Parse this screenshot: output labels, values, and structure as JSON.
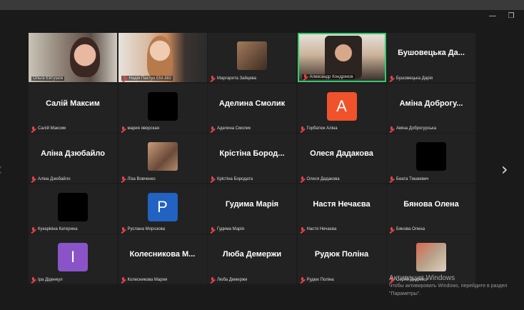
{
  "window": {
    "min_icon": "—",
    "max_icon": "❐"
  },
  "nav": {
    "left_icon": "‹",
    "right_icon": "›"
  },
  "tiles": [
    {
      "row": 0,
      "col": 0,
      "type": "video",
      "label": "Ольга Євтушок",
      "mic": false
    },
    {
      "row": 0,
      "col": 1,
      "type": "video",
      "label": "Надія Пастух ЕМ-382",
      "mic": true
    },
    {
      "row": 0,
      "col": 2,
      "type": "photo",
      "label": "Маргарита Зайцева",
      "mic": true
    },
    {
      "row": 0,
      "col": 3,
      "type": "video",
      "label": "Александр Кондряков",
      "mic": true,
      "active": true
    },
    {
      "row": 0,
      "col": 4,
      "type": "name",
      "name": "Бушовецька Да...",
      "label": "Бушовецька Дарія",
      "mic": true
    },
    {
      "row": 1,
      "col": 0,
      "type": "name",
      "name": "Салій Максим",
      "label": "Салій Максим",
      "mic": true
    },
    {
      "row": 1,
      "col": 1,
      "type": "avatar",
      "avatar": "",
      "avatar_color": "#000000",
      "label": "мария яворская",
      "mic": true
    },
    {
      "row": 1,
      "col": 2,
      "type": "name",
      "name": "Аделина Смолик",
      "label": "Аделина Смолик",
      "mic": true
    },
    {
      "row": 1,
      "col": 3,
      "type": "avatar",
      "avatar": "A",
      "avatar_color": "#f0522c",
      "label": "Горбатюк Аліна",
      "mic": true
    },
    {
      "row": 1,
      "col": 4,
      "type": "name",
      "name": "Аміна Доброгу...",
      "label": "Аміна Доброгурська",
      "mic": true
    },
    {
      "row": 2,
      "col": 0,
      "type": "name",
      "name": "Аліна Дзюбайло",
      "label": "Аліна Дзюбайло",
      "mic": true
    },
    {
      "row": 2,
      "col": 1,
      "type": "photo",
      "label": "Ліза Вовченко",
      "mic": true
    },
    {
      "row": 2,
      "col": 2,
      "type": "name",
      "name": "Крістіна Бород...",
      "label": "Крістіна Бородата",
      "mic": true
    },
    {
      "row": 2,
      "col": 3,
      "type": "name",
      "name": "Олеся Дадакова",
      "label": "Олеся Дадакова",
      "mic": true
    },
    {
      "row": 2,
      "col": 4,
      "type": "avatar",
      "avatar": "",
      "avatar_color": "#000000",
      "label": "Беата Тишкевич",
      "mic": true
    },
    {
      "row": 3,
      "col": 0,
      "type": "avatar",
      "avatar": "",
      "avatar_color": "#000000",
      "label": "Кукарікіна Катерина",
      "mic": true
    },
    {
      "row": 3,
      "col": 1,
      "type": "avatar",
      "avatar": "P",
      "avatar_color": "#2162c2",
      "label": "Руслана Морозова",
      "mic": true
    },
    {
      "row": 3,
      "col": 2,
      "type": "name",
      "name": "Гудима Марія",
      "label": "Гудима Марія",
      "mic": true
    },
    {
      "row": 3,
      "col": 3,
      "type": "name",
      "name": "Настя Нечаєва",
      "label": "Настя Нечаєва",
      "mic": true
    },
    {
      "row": 3,
      "col": 4,
      "type": "name",
      "name": "Бянова Олена",
      "label": "Бянова Олена",
      "mic": true
    },
    {
      "row": 4,
      "col": 0,
      "type": "avatar",
      "avatar": "I",
      "avatar_color": "#8a54c8",
      "label": "Іра Діденкул",
      "mic": true
    },
    {
      "row": 4,
      "col": 1,
      "type": "name",
      "name": "Колесникова М...",
      "label": "Колесникова Мария",
      "mic": true
    },
    {
      "row": 4,
      "col": 2,
      "type": "name",
      "name": "Люба Демержи",
      "label": "Люба Демержи",
      "mic": true
    },
    {
      "row": 4,
      "col": 3,
      "type": "name",
      "name": "Рудюк Поліна",
      "label": "Рудюк Поліна",
      "mic": true
    },
    {
      "row": 4,
      "col": 4,
      "type": "photo",
      "label": "Сергій Дидинко",
      "mic": true
    }
  ],
  "watermark": {
    "title": "Активация Windows",
    "line1": "Чтобы активировать Windows, перейдите в раздел",
    "line2": "\"Параметры\"."
  },
  "colors": {
    "active_border": "#2ecc71",
    "mic_muted": "#e14545"
  }
}
